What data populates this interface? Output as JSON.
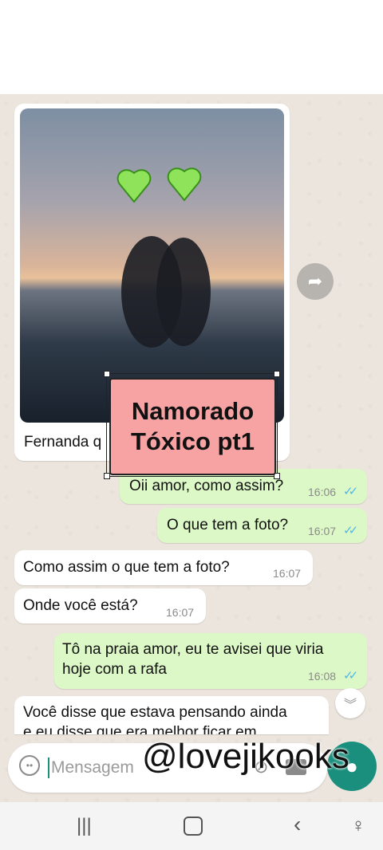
{
  "chat": {
    "photo_caption": "Fernanda q",
    "messages": [
      {
        "text": "Oii amor, como assim?",
        "time": "16:06",
        "ticks": "✓✓"
      },
      {
        "text": "O que tem a foto?",
        "time": "16:07",
        "ticks": "✓✓"
      },
      {
        "text": "Como assim o que tem a foto?",
        "time": "16:07"
      },
      {
        "text": "Onde você está?",
        "time": "16:07"
      },
      {
        "text_line1": "Tô na praia amor, eu te avisei que viria",
        "text_line2": "hoje com a rafa",
        "time": "16:08",
        "ticks": "✓✓"
      },
      {
        "text_line1": "Você disse que estava pensando ainda",
        "text_line2": "e eu disse que era melhor ficar em"
      }
    ]
  },
  "overlay": {
    "line1": "Namorado",
    "line2": "Tóxico pt1"
  },
  "input": {
    "placeholder": "Mensagem"
  },
  "watermark": "@lovejikooks",
  "icons": {
    "forward": "forward-icon",
    "emoji": "emoji-icon",
    "attach": "attach-icon",
    "camera": "camera-icon",
    "mic": "mic-icon",
    "scroll_down": "chevron-down-icon"
  },
  "colors": {
    "outgoing": "#dcf8c6",
    "incoming": "#ffffff",
    "accent": "#1a8f7d",
    "overlay": "#f7a3a3"
  }
}
